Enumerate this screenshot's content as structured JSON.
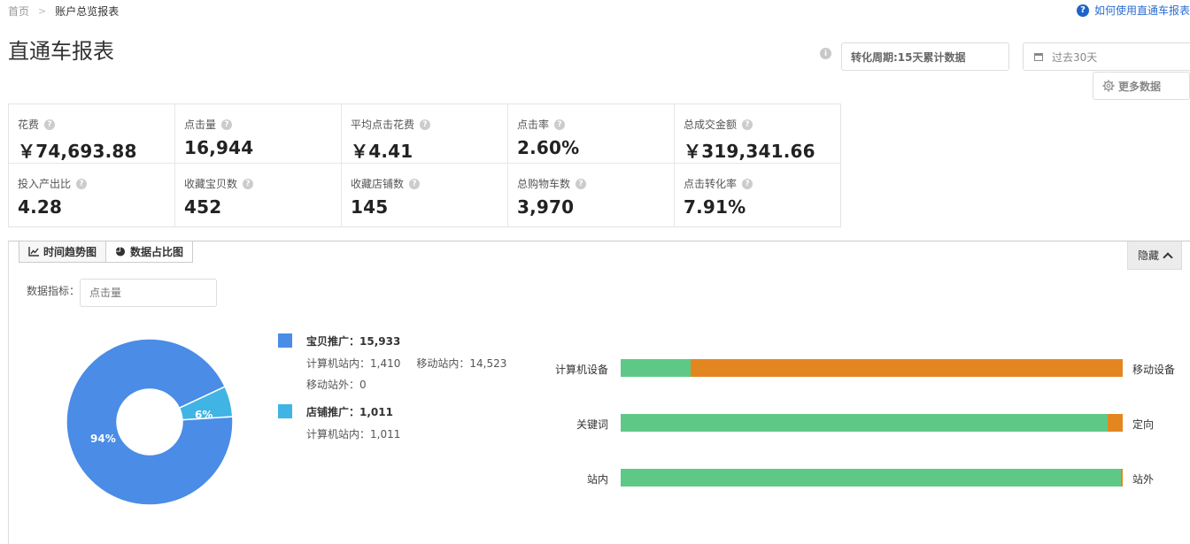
{
  "breadcrumb": {
    "home": "首页",
    "current": "账户总览报表"
  },
  "help_link": {
    "label": "如何使用直通车报表"
  },
  "page_title": "直通车报表",
  "controls": {
    "period_label": "转化周期:15天累计数据",
    "date_range": "过去30天",
    "more_data": "更多数据"
  },
  "metrics": [
    {
      "label": "花费",
      "value": "￥74,693.88"
    },
    {
      "label": "点击量",
      "value": "16,944"
    },
    {
      "label": "平均点击花费",
      "value": "￥4.41"
    },
    {
      "label": "点击率",
      "value": "2.60%"
    },
    {
      "label": "总成交金额",
      "value": "￥319,341.66"
    },
    {
      "label": "投入产出比",
      "value": "4.28"
    },
    {
      "label": "收藏宝贝数",
      "value": "452"
    },
    {
      "label": "收藏店铺数",
      "value": "145"
    },
    {
      "label": "总购物车数",
      "value": "3,970"
    },
    {
      "label": "点击转化率",
      "value": "7.91%"
    }
  ],
  "chart_panel": {
    "tabs": [
      {
        "label": "时间趋势图",
        "icon": "line-chart-icon"
      },
      {
        "label": "数据占比图",
        "icon": "pie-chart-icon"
      }
    ],
    "hide_label": "隐藏",
    "filter_label": "数据指标：",
    "filter_placeholder": "点击量"
  },
  "legend": {
    "item1": {
      "title": "宝贝推广：15,933",
      "sub1": "计算机站内：1,410",
      "sub2": "移动站内：14,523",
      "sub3": "移动站外：0"
    },
    "item2": {
      "title": "店铺推广：1,011",
      "sub1": "计算机站内：1,011"
    }
  },
  "chart_data": [
    {
      "type": "pie",
      "donut": true,
      "labels": [
        "宝贝推广",
        "店铺推广"
      ],
      "values": [
        15933,
        1011
      ],
      "data_labels": [
        "94%",
        "6%"
      ],
      "colors": [
        "#4a8ce6",
        "#40b4e4"
      ]
    },
    {
      "type": "bar",
      "stacked": true,
      "orientation": "horizontal",
      "rows": [
        {
          "left": "计算机设备",
          "right": "移动设备",
          "left_share": 0.139
        },
        {
          "left": "关键词",
          "right": "定向",
          "left_share": 0.97
        },
        {
          "left": "站内",
          "right": "站外",
          "left_share": 0.997
        }
      ],
      "colors": {
        "left": "#5ec987",
        "right": "#e4861f"
      }
    }
  ]
}
